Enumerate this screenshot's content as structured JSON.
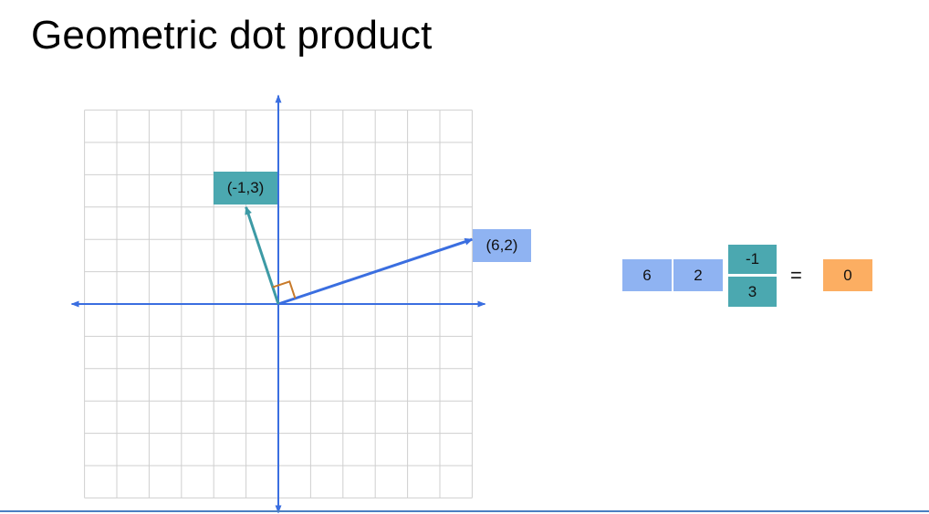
{
  "title": "Geometric dot product",
  "vector_a": {
    "label": "(6,2)",
    "x": 6,
    "y": 2,
    "color": "#3a6ee0"
  },
  "vector_b": {
    "label": "(-1,3)",
    "x": -1,
    "y": 3,
    "color": "#3d9aa5"
  },
  "right_angle_color": "#c87a2a",
  "axis_color": "#3a6ee0",
  "grid": {
    "x_range": [
      -6,
      6
    ],
    "y_range": [
      -6,
      6
    ]
  },
  "equation": {
    "row_vector": [
      "6",
      "2"
    ],
    "column_vector": [
      "-1",
      "3"
    ],
    "equals": "=",
    "result": "0"
  },
  "colors": {
    "row": "#8fb3f2",
    "column": "#4ba8b0",
    "result": "#fcae62"
  }
}
